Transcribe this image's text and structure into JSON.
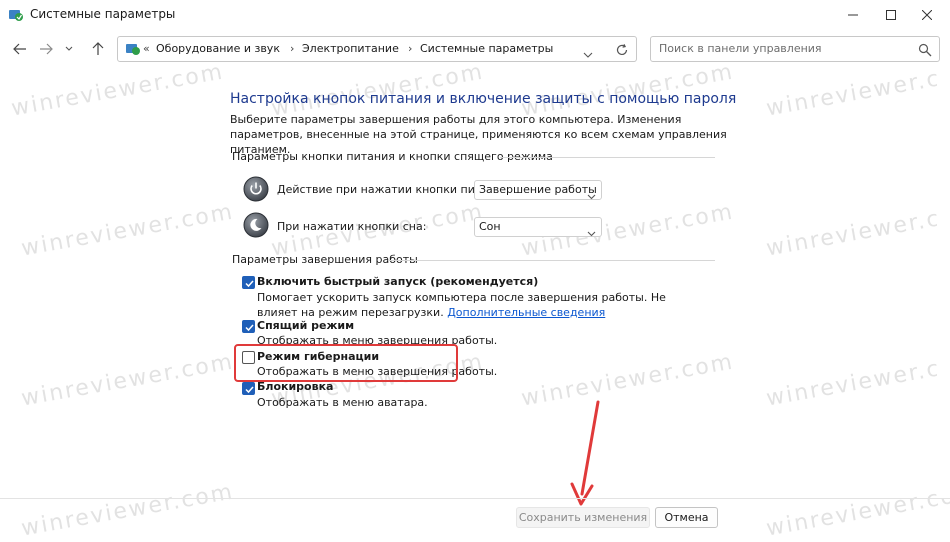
{
  "window": {
    "title": "Системные параметры"
  },
  "address": {
    "crumbs": [
      "Оборудование и звук",
      "Электропитание",
      "Системные параметры"
    ],
    "sep": "›",
    "lead_sep": "«"
  },
  "search": {
    "placeholder": "Поиск в панели управления"
  },
  "content": {
    "heading": "Настройка кнопок питания и включение защиты с помощью пароля",
    "description": "Выберите параметры завершения работы для этого компьютера. Изменения параметров, внесенные на этой странице, применяются ко всем схемам управления питанием.",
    "power_section": {
      "title": "Параметры кнопки питания и кнопки спящего режима",
      "power_button": {
        "label": "Действие при нажатии кнопки питания:",
        "value": "Завершение работы"
      },
      "sleep_button": {
        "label": "При нажатии кнопки сна:",
        "value": "Сон"
      }
    },
    "shutdown_section": {
      "title": "Параметры завершения работы",
      "options": [
        {
          "title": "Включить быстрый запуск (рекомендуется)",
          "desc": "Помогает ускорить запуск компьютера после завершения работы. Не влияет на режим перезагрузки.",
          "link": "Дополнительные сведения",
          "checked": true
        },
        {
          "title": "Спящий режим",
          "desc": "Отображать в меню завершения работы.",
          "checked": true
        },
        {
          "title": "Режим гибернации",
          "desc": "Отображать в меню завершения работы.",
          "checked": false
        },
        {
          "title": "Блокировка",
          "desc": "Отображать в меню аватара.",
          "checked": true
        }
      ]
    }
  },
  "footer": {
    "save_label": "Сохранить изменения",
    "cancel_label": "Отмена"
  },
  "watermark": "winreviewer.com",
  "colors": {
    "heading": "#1e3a8f",
    "link": "#0b57d0",
    "checkbox": "#1f5fb8",
    "highlight": "#e03a3a",
    "arrow": "#e03a3a"
  }
}
